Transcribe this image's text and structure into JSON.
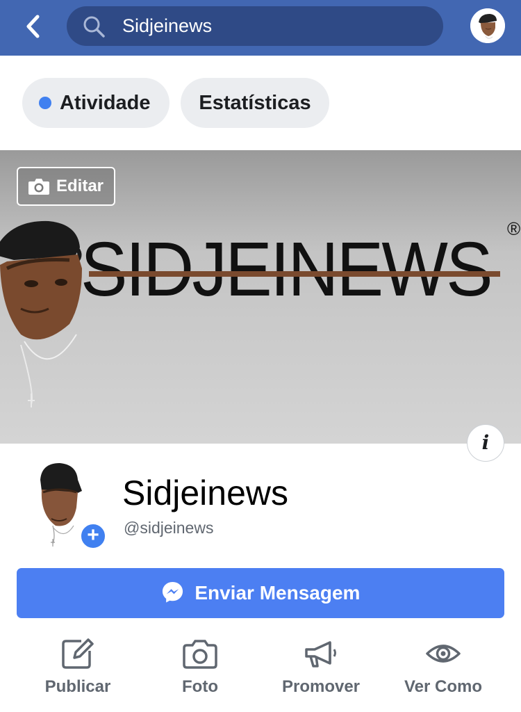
{
  "header": {
    "search_value": "Sidjeinews"
  },
  "tabs": [
    {
      "label": "Atividade"
    },
    {
      "label": "Estatísticas"
    }
  ],
  "cover": {
    "edit_label": "Editar",
    "banner_text": "SIDJEINEWS",
    "registered_mark": "®",
    "info_label": "i"
  },
  "profile": {
    "name": "Sidjeinews",
    "handle": "@sidjeinews",
    "add_label": "+"
  },
  "message_button": {
    "label": "Enviar Mensagem"
  },
  "actions": [
    {
      "label": "Publicar",
      "icon": "edit-icon"
    },
    {
      "label": "Foto",
      "icon": "camera-icon"
    },
    {
      "label": "Promover",
      "icon": "megaphone-icon"
    },
    {
      "label": "Ver Como",
      "icon": "eye-icon"
    }
  ],
  "colors": {
    "header_blue": "#4267b2",
    "search_bg": "#2f4a86",
    "accent_blue": "#4c7ff2",
    "tab_bg": "#ebedf0"
  }
}
